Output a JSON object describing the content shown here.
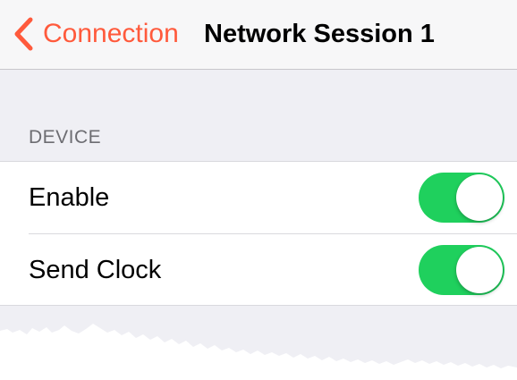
{
  "navbar": {
    "back_label": "Connection",
    "title": "Network Session 1"
  },
  "section": {
    "header": "DEVICE"
  },
  "rows": [
    {
      "label": "Enable",
      "toggle_on": true
    },
    {
      "label": "Send Clock",
      "toggle_on": true
    }
  ],
  "colors": {
    "accent": "#ff5a3c",
    "toggle_on": "#1fd05d",
    "background": "#efeff4"
  },
  "icons": {
    "back": "chevron-left-icon"
  }
}
